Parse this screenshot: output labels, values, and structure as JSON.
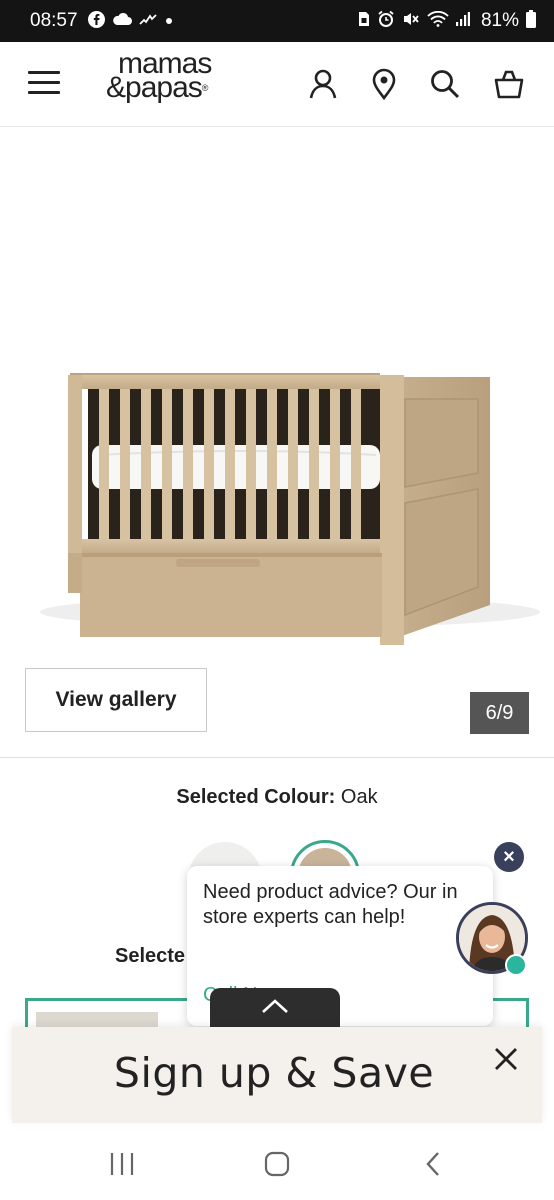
{
  "status_bar": {
    "time": "08:57",
    "battery": "81%",
    "left_icons": [
      "facebook-icon",
      "cloud-icon",
      "activity-icon",
      "dot-icon"
    ],
    "right_icons": [
      "sim-icon",
      "alarm-icon",
      "mute-icon",
      "wifi-icon",
      "signal-icon",
      "battery-icon"
    ]
  },
  "header": {
    "logo_line1": "mamas",
    "logo_line2": "&papas",
    "logo_mark": "®",
    "icons": [
      "menu-icon",
      "account-icon",
      "store-locator-icon",
      "search-icon",
      "basket-icon"
    ]
  },
  "gallery": {
    "view_gallery_label": "View gallery",
    "counter": "6/9"
  },
  "colour": {
    "label": "Selected Colour:",
    "value": "Oak",
    "swatches": [
      {
        "name": "white",
        "color": "#efefee",
        "selected": false
      },
      {
        "name": "oak",
        "color": "#c9b49a",
        "selected": true
      }
    ]
  },
  "size": {
    "label": "Selecte"
  },
  "chat_popup": {
    "message": "Need product advice? Our in store experts can help!",
    "link": "Call N",
    "close_glyph": "×"
  },
  "signup": {
    "title": "Sign up & Save"
  },
  "colors": {
    "accent": "#3aa88a",
    "dark": "#2d2d2d",
    "navy": "#3a3f5c",
    "banner_bg": "#f4f1ec"
  }
}
